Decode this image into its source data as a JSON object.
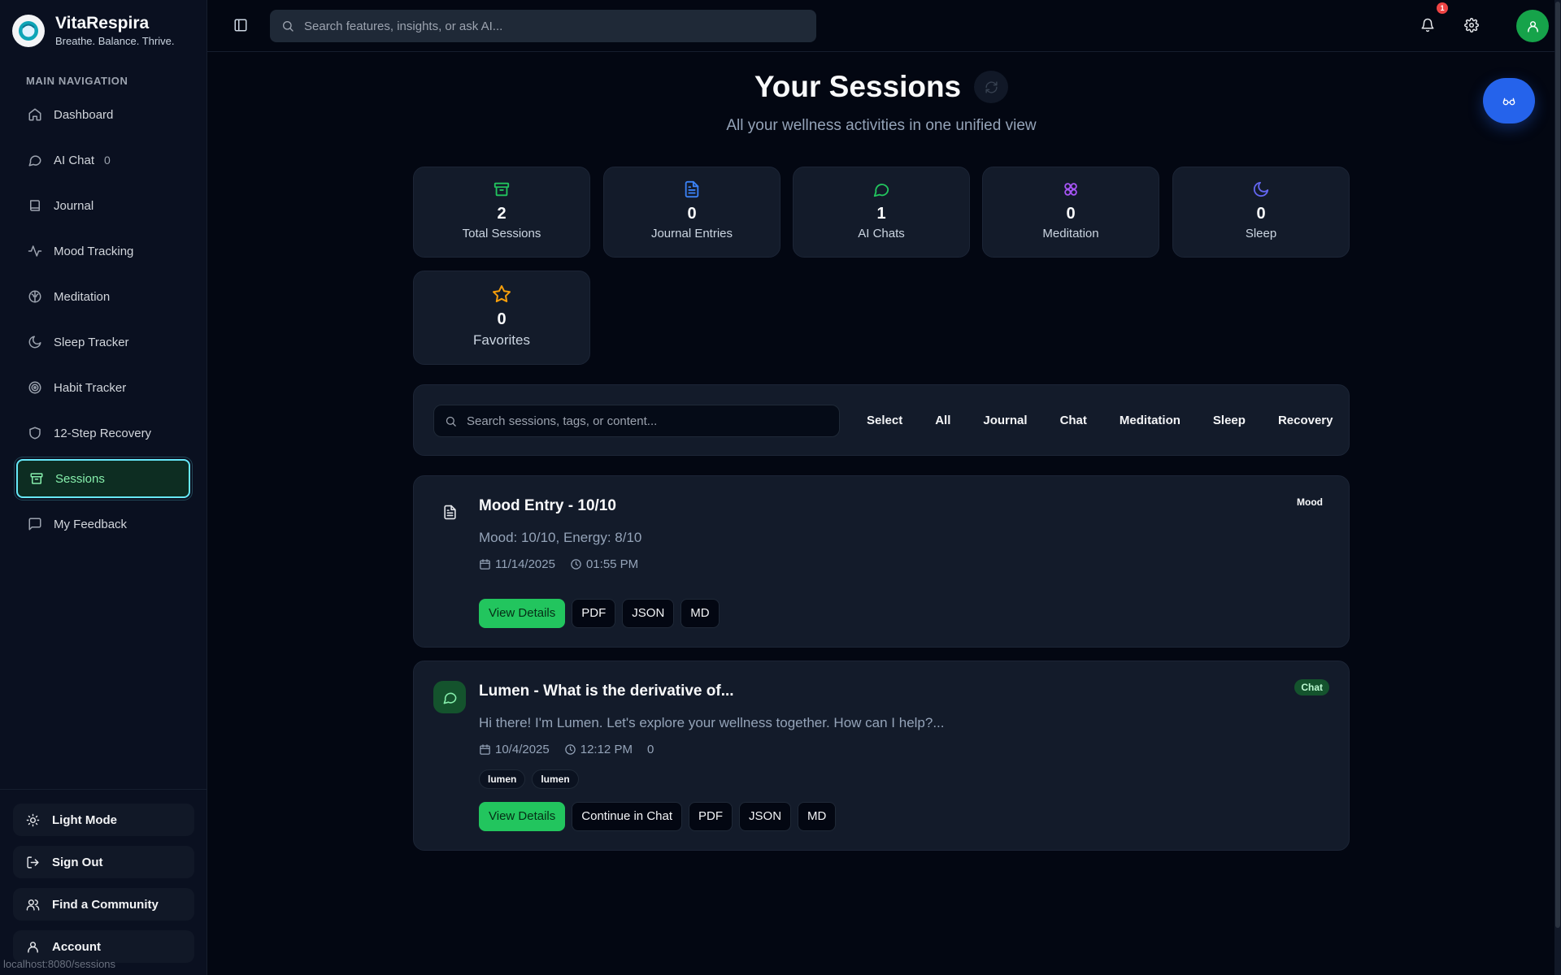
{
  "brand": {
    "name": "VitaRespira",
    "tagline": "Breathe. Balance. Thrive."
  },
  "sidebar": {
    "section_title": "MAIN NAVIGATION",
    "items": [
      {
        "label": "Dashboard",
        "icon": "home-icon"
      },
      {
        "label": "AI Chat",
        "icon": "chat-icon",
        "count": "0"
      },
      {
        "label": "Journal",
        "icon": "book-icon"
      },
      {
        "label": "Mood Tracking",
        "icon": "activity-icon"
      },
      {
        "label": "Meditation",
        "icon": "brain-icon"
      },
      {
        "label": "Sleep Tracker",
        "icon": "moon-icon"
      },
      {
        "label": "Habit Tracker",
        "icon": "target-icon"
      },
      {
        "label": "12-Step Recovery",
        "icon": "shield-icon"
      },
      {
        "label": "Sessions",
        "icon": "archive-icon",
        "active": true
      },
      {
        "label": "My Feedback",
        "icon": "message-square-icon"
      }
    ],
    "bottom": {
      "light_mode": "Light Mode",
      "sign_out": "Sign Out",
      "community": "Find a Community",
      "account": "Account"
    },
    "status_url": "localhost:8080/sessions"
  },
  "topbar": {
    "search_placeholder": "Search features, insights, or ask AI...",
    "notification_count": "1"
  },
  "header": {
    "title": "Your Sessions",
    "subtitle": "All your wellness activities in one unified view"
  },
  "stats": [
    {
      "value": "2",
      "label": "Total Sessions",
      "color": "#22c55e"
    },
    {
      "value": "0",
      "label": "Journal Entries",
      "color": "#3b82f6"
    },
    {
      "value": "1",
      "label": "AI Chats",
      "color": "#22c55e"
    },
    {
      "value": "0",
      "label": "Meditation",
      "color": "#a855f7"
    },
    {
      "value": "0",
      "label": "Sleep",
      "color": "#6366f1"
    },
    {
      "value": "0",
      "label": "Favorites",
      "color": "#f59e0b"
    }
  ],
  "filters": {
    "search_placeholder": "Search sessions, tags, or content...",
    "buttons": [
      "Select",
      "All",
      "Journal",
      "Chat",
      "Meditation",
      "Sleep",
      "Recovery"
    ]
  },
  "sessions": [
    {
      "title": "Mood Entry - 10/10",
      "badge": "Mood",
      "description": "Mood: 10/10, Energy: 8/10",
      "date": "11/14/2025",
      "time": "01:55 PM",
      "actions": [
        "View Details",
        "PDF",
        "JSON",
        "MD"
      ]
    },
    {
      "title": "Lumen - What is the derivative of...",
      "badge": "Chat",
      "description": "Hi there! I'm Lumen. Let's explore your wellness together. How can I help?...",
      "date": "10/4/2025",
      "time": "12:12 PM",
      "message_count": "0",
      "tags": [
        "lumen",
        "lumen"
      ],
      "actions": [
        "View Details",
        "Continue in Chat",
        "PDF",
        "JSON",
        "MD"
      ]
    }
  ]
}
